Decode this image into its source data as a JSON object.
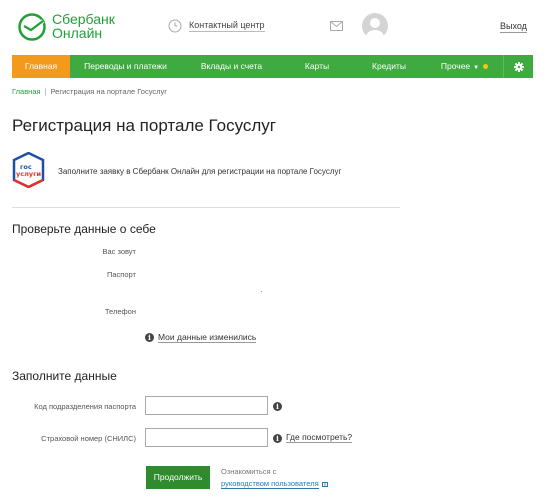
{
  "header": {
    "brand_name": "Сбербанк",
    "brand_sub": "Онлайн",
    "contact_label": "Контактный центр",
    "logout_label": "Выход",
    "brand_color": "#21a038"
  },
  "nav": {
    "items": [
      {
        "label": "Главная",
        "active": true
      },
      {
        "label": "Переводы и платежи"
      },
      {
        "label": "Вклады и счета"
      },
      {
        "label": "Карты"
      },
      {
        "label": "Кредиты"
      },
      {
        "label": "Прочее"
      }
    ],
    "active_color": "#f39a1c",
    "bar_color": "#3eaa3f",
    "settings_icon": "gear-icon"
  },
  "breadcrumb": {
    "home": "Главная",
    "separator": "|",
    "current": "Регистрация на портале Госуслуг"
  },
  "page": {
    "title": "Регистрация на портале Госуслуг",
    "intro": "Заполните заявку в Сбербанк Онлайн для регистрации на портале Госуслуг",
    "gos_logo_line1": "гос",
    "gos_logo_line2": "услуги"
  },
  "check_section": {
    "title": "Проверьте данные о себе",
    "name_label": "Вас зовут",
    "passport_label": "Паспорт",
    "phone_label": "Телефон",
    "changed_link": "Мои данные изменились"
  },
  "fill_section": {
    "title": "Заполните данные",
    "passport_code_label": "Код подразделения паспорта",
    "passport_code_value": "",
    "snils_label": "Страховой номер (СНИЛС)",
    "snils_value": "",
    "where_link": "Где посмотреть?"
  },
  "actions": {
    "continue_label": "Продолжить",
    "guide_line1": "Ознакомиться с",
    "guide_line2": "руководством пользователя"
  }
}
